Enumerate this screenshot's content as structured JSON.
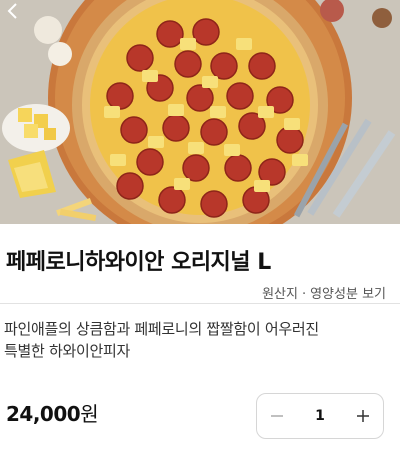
{
  "product": {
    "name": "페페로니하와이안 오리지널 L",
    "description_line1": "파인애플의 상큼함과 페페로니의 짭짤함이 어우러진",
    "description_line2": "특별한 하와이안피자",
    "price_number": "24,000",
    "price_unit": "원"
  },
  "links": {
    "origin": "원산지",
    "separator": "·",
    "nutrition": "영양성분 보기"
  },
  "quantity": {
    "value": "1",
    "decrease_icon": "minus-icon",
    "increase_icon": "plus-icon"
  },
  "nav": {
    "back_icon": "chevron-left-icon"
  }
}
